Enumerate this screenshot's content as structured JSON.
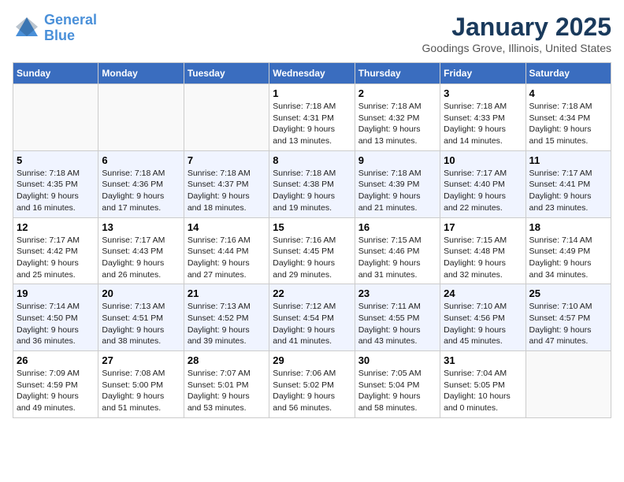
{
  "header": {
    "logo_line1": "General",
    "logo_line2": "Blue",
    "month_title": "January 2025",
    "location": "Goodings Grove, Illinois, United States"
  },
  "weekdays": [
    "Sunday",
    "Monday",
    "Tuesday",
    "Wednesday",
    "Thursday",
    "Friday",
    "Saturday"
  ],
  "weeks": [
    [
      {
        "day": "",
        "info": ""
      },
      {
        "day": "",
        "info": ""
      },
      {
        "day": "",
        "info": ""
      },
      {
        "day": "1",
        "info": "Sunrise: 7:18 AM\nSunset: 4:31 PM\nDaylight: 9 hours\nand 13 minutes."
      },
      {
        "day": "2",
        "info": "Sunrise: 7:18 AM\nSunset: 4:32 PM\nDaylight: 9 hours\nand 13 minutes."
      },
      {
        "day": "3",
        "info": "Sunrise: 7:18 AM\nSunset: 4:33 PM\nDaylight: 9 hours\nand 14 minutes."
      },
      {
        "day": "4",
        "info": "Sunrise: 7:18 AM\nSunset: 4:34 PM\nDaylight: 9 hours\nand 15 minutes."
      }
    ],
    [
      {
        "day": "5",
        "info": "Sunrise: 7:18 AM\nSunset: 4:35 PM\nDaylight: 9 hours\nand 16 minutes."
      },
      {
        "day": "6",
        "info": "Sunrise: 7:18 AM\nSunset: 4:36 PM\nDaylight: 9 hours\nand 17 minutes."
      },
      {
        "day": "7",
        "info": "Sunrise: 7:18 AM\nSunset: 4:37 PM\nDaylight: 9 hours\nand 18 minutes."
      },
      {
        "day": "8",
        "info": "Sunrise: 7:18 AM\nSunset: 4:38 PM\nDaylight: 9 hours\nand 19 minutes."
      },
      {
        "day": "9",
        "info": "Sunrise: 7:18 AM\nSunset: 4:39 PM\nDaylight: 9 hours\nand 21 minutes."
      },
      {
        "day": "10",
        "info": "Sunrise: 7:17 AM\nSunset: 4:40 PM\nDaylight: 9 hours\nand 22 minutes."
      },
      {
        "day": "11",
        "info": "Sunrise: 7:17 AM\nSunset: 4:41 PM\nDaylight: 9 hours\nand 23 minutes."
      }
    ],
    [
      {
        "day": "12",
        "info": "Sunrise: 7:17 AM\nSunset: 4:42 PM\nDaylight: 9 hours\nand 25 minutes."
      },
      {
        "day": "13",
        "info": "Sunrise: 7:17 AM\nSunset: 4:43 PM\nDaylight: 9 hours\nand 26 minutes."
      },
      {
        "day": "14",
        "info": "Sunrise: 7:16 AM\nSunset: 4:44 PM\nDaylight: 9 hours\nand 27 minutes."
      },
      {
        "day": "15",
        "info": "Sunrise: 7:16 AM\nSunset: 4:45 PM\nDaylight: 9 hours\nand 29 minutes."
      },
      {
        "day": "16",
        "info": "Sunrise: 7:15 AM\nSunset: 4:46 PM\nDaylight: 9 hours\nand 31 minutes."
      },
      {
        "day": "17",
        "info": "Sunrise: 7:15 AM\nSunset: 4:48 PM\nDaylight: 9 hours\nand 32 minutes."
      },
      {
        "day": "18",
        "info": "Sunrise: 7:14 AM\nSunset: 4:49 PM\nDaylight: 9 hours\nand 34 minutes."
      }
    ],
    [
      {
        "day": "19",
        "info": "Sunrise: 7:14 AM\nSunset: 4:50 PM\nDaylight: 9 hours\nand 36 minutes."
      },
      {
        "day": "20",
        "info": "Sunrise: 7:13 AM\nSunset: 4:51 PM\nDaylight: 9 hours\nand 38 minutes."
      },
      {
        "day": "21",
        "info": "Sunrise: 7:13 AM\nSunset: 4:52 PM\nDaylight: 9 hours\nand 39 minutes."
      },
      {
        "day": "22",
        "info": "Sunrise: 7:12 AM\nSunset: 4:54 PM\nDaylight: 9 hours\nand 41 minutes."
      },
      {
        "day": "23",
        "info": "Sunrise: 7:11 AM\nSunset: 4:55 PM\nDaylight: 9 hours\nand 43 minutes."
      },
      {
        "day": "24",
        "info": "Sunrise: 7:10 AM\nSunset: 4:56 PM\nDaylight: 9 hours\nand 45 minutes."
      },
      {
        "day": "25",
        "info": "Sunrise: 7:10 AM\nSunset: 4:57 PM\nDaylight: 9 hours\nand 47 minutes."
      }
    ],
    [
      {
        "day": "26",
        "info": "Sunrise: 7:09 AM\nSunset: 4:59 PM\nDaylight: 9 hours\nand 49 minutes."
      },
      {
        "day": "27",
        "info": "Sunrise: 7:08 AM\nSunset: 5:00 PM\nDaylight: 9 hours\nand 51 minutes."
      },
      {
        "day": "28",
        "info": "Sunrise: 7:07 AM\nSunset: 5:01 PM\nDaylight: 9 hours\nand 53 minutes."
      },
      {
        "day": "29",
        "info": "Sunrise: 7:06 AM\nSunset: 5:02 PM\nDaylight: 9 hours\nand 56 minutes."
      },
      {
        "day": "30",
        "info": "Sunrise: 7:05 AM\nSunset: 5:04 PM\nDaylight: 9 hours\nand 58 minutes."
      },
      {
        "day": "31",
        "info": "Sunrise: 7:04 AM\nSunset: 5:05 PM\nDaylight: 10 hours\nand 0 minutes."
      },
      {
        "day": "",
        "info": ""
      }
    ]
  ]
}
